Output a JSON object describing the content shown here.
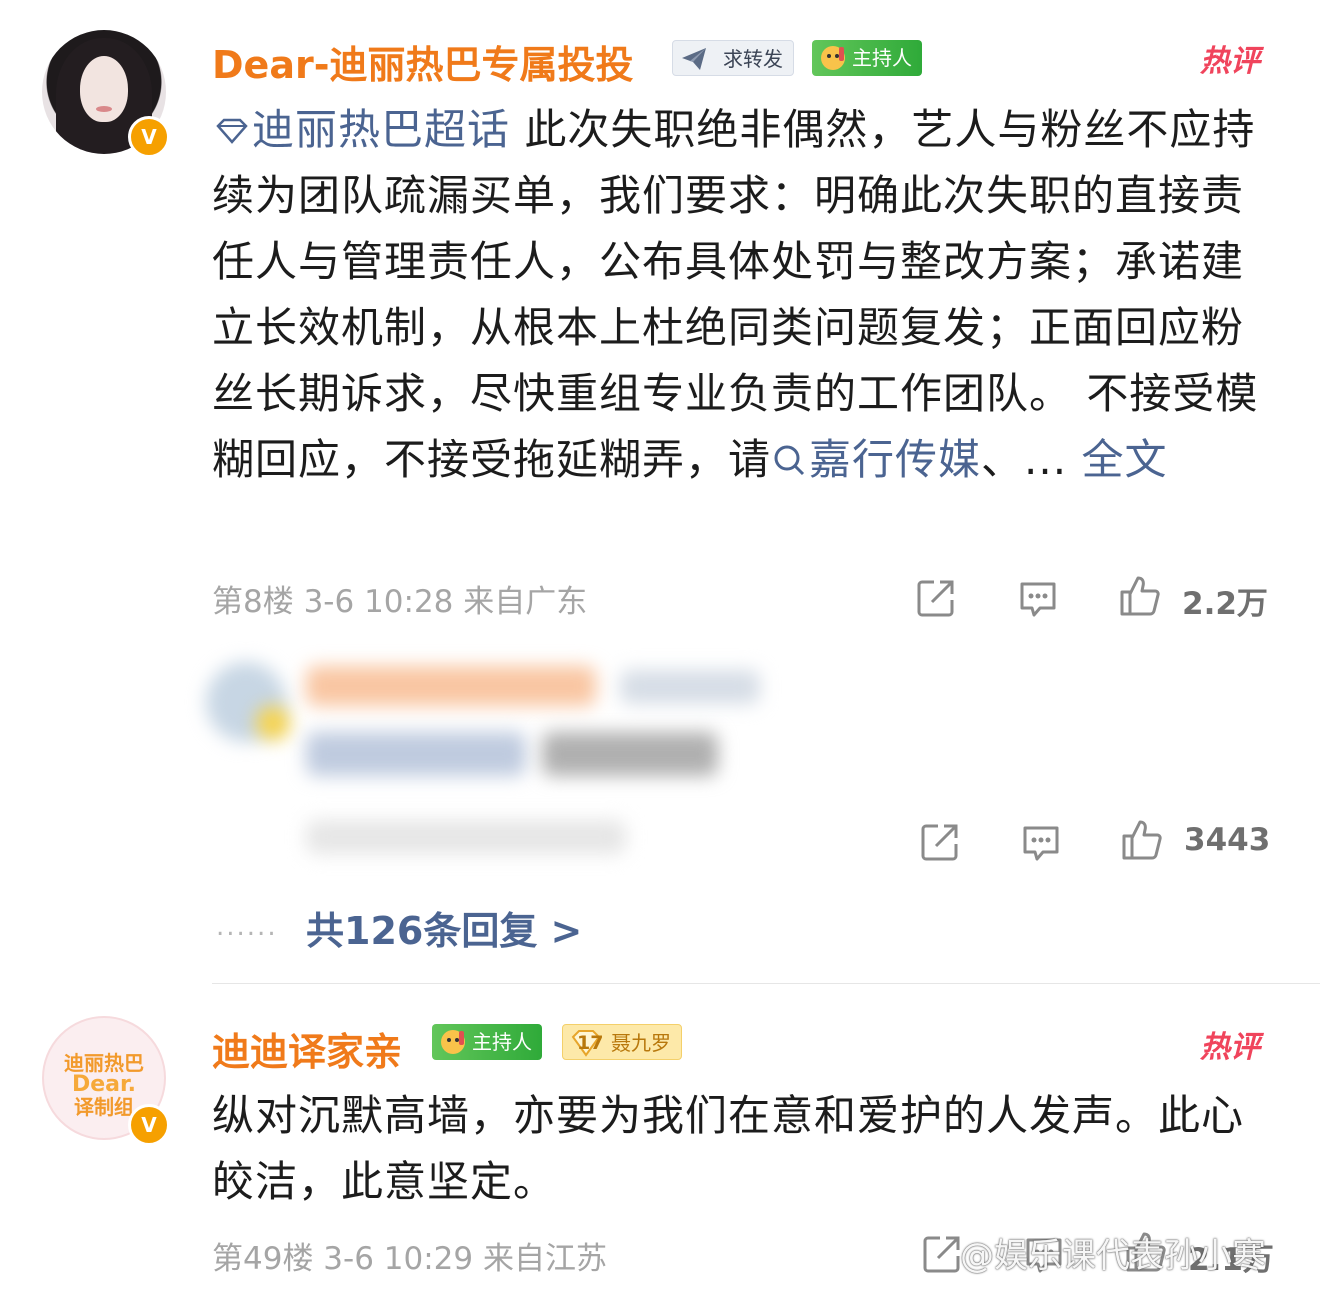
{
  "colors": {
    "name_orange": "#f07a1a",
    "link_blue": "#4b6491",
    "hot_red": "#f0445c",
    "meta_gray": "#a5a5a5",
    "host_green": "#2faa39"
  },
  "comments": [
    {
      "username": "Dear-迪丽热巴专属投投",
      "tags": [
        "求转发",
        "主持人"
      ],
      "hot_label": "热评",
      "topic_link": "迪丽热巴超话",
      "text": "此次失职绝非偶然，艺人与粉丝不应持续为团队疏漏买单，我们要求：明确此次失职的直接责任人与管理责任人，公布具体处罚与整改方案；承诺建立长效机制，从根本上杜绝同类问题复发；正面回应粉丝长期诉求，尽快重组专业负责的工作团队。 不接受模糊回应，不接受拖延糊弄，请",
      "mention_link": "嘉行传媒",
      "ellipsis": "、... ",
      "full_text_link": "全文",
      "meta": "第8楼 3-6 10:28 来自广东",
      "like_count": "2.2万",
      "verified_icon": "v-badge-icon"
    },
    {
      "username": "迪迪译家亲",
      "tags": [
        "主持人",
        "聂九罗"
      ],
      "level": "17",
      "hot_label": "热评",
      "avatar_text": [
        "迪丽热巴",
        "Dear.",
        "译制组"
      ],
      "text": "纵对沉默高墙，亦要为我们在意和爱护的人发声。此心皎洁，此意坚定。",
      "meta": "第49楼 3-6 10:29 来自江苏",
      "like_count": "2.1万",
      "verified_icon": "v-badge-icon"
    }
  ],
  "reply_preview": {
    "like_count": "3443",
    "total_replies": "共126条回复 >",
    "dots": "......"
  },
  "watermark": "@娱乐课代表孙小寒"
}
